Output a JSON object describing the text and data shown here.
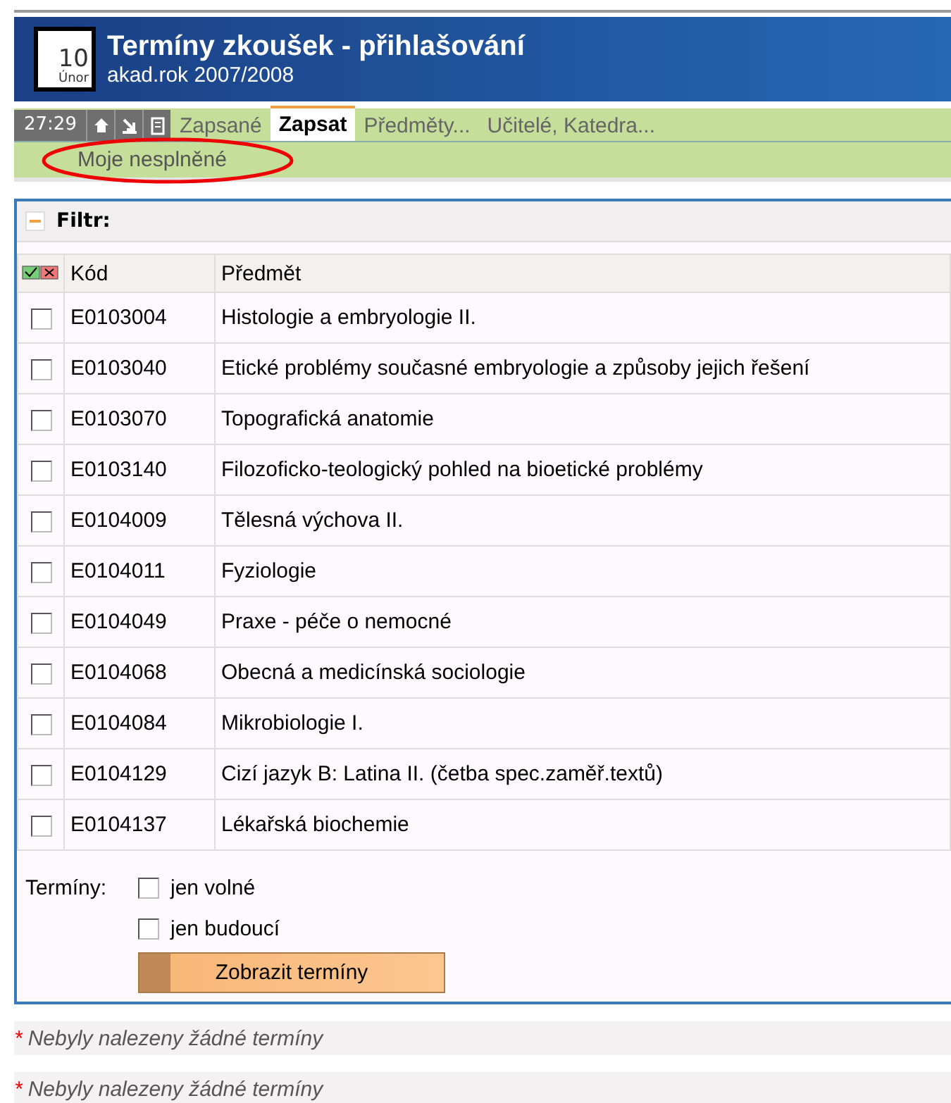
{
  "header": {
    "calendar_day": "10",
    "calendar_month": "Únor",
    "title": "Termíny zkoušek - přihlašování",
    "subtitle": "akad.rok 2007/2008"
  },
  "toolbar": {
    "timer": "27:29",
    "tabs": [
      {
        "label": "Zapsané",
        "selected": false
      },
      {
        "label": "Zapsat",
        "selected": true
      },
      {
        "label": "Předměty...",
        "selected": false
      },
      {
        "label": "Učitelé, Katedra...",
        "selected": false
      }
    ]
  },
  "subnav": {
    "items": [
      {
        "label": "Moje nesplněné",
        "circled": true
      }
    ]
  },
  "filter": {
    "title": "Filtr:",
    "expanded": true,
    "table": {
      "columns": [
        "Kód",
        "Předmět"
      ],
      "rows": [
        {
          "code": "E0103004",
          "subject": "Histologie a embryologie II.",
          "checked": false
        },
        {
          "code": "E0103040",
          "subject": "Etické problémy současné embryologie a způsoby jejich řešení",
          "checked": false
        },
        {
          "code": "E0103070",
          "subject": "Topografická anatomie",
          "checked": false
        },
        {
          "code": "E0103140",
          "subject": "Filozoficko-teologický pohled na bioetické problémy",
          "checked": false
        },
        {
          "code": "E0104009",
          "subject": "Tělesná výchova II.",
          "checked": false
        },
        {
          "code": "E0104011",
          "subject": "Fyziologie",
          "checked": false
        },
        {
          "code": "E0104049",
          "subject": "Praxe - péče o nemocné",
          "checked": false
        },
        {
          "code": "E0104068",
          "subject": "Obecná a medicínská sociologie",
          "checked": false
        },
        {
          "code": "E0104084",
          "subject": "Mikrobiologie I.",
          "checked": false
        },
        {
          "code": "E0104129",
          "subject": "Cizí jazyk B: Latina II. (četba spec.zaměř.textů)",
          "checked": false
        },
        {
          "code": "E0104137",
          "subject": "Lékařská biochemie",
          "checked": false
        }
      ]
    },
    "terms_label": "Termíny:",
    "options": [
      {
        "label": "jen volné",
        "checked": false
      },
      {
        "label": "jen budoucí",
        "checked": false
      }
    ],
    "button": "Zobrazit termíny"
  },
  "messages": [
    {
      "mark": "*",
      "text": "Nebyly nalezeny žádné termíny"
    },
    {
      "mark": "*",
      "text": "Nebyly nalezeny žádné termíny"
    }
  ]
}
